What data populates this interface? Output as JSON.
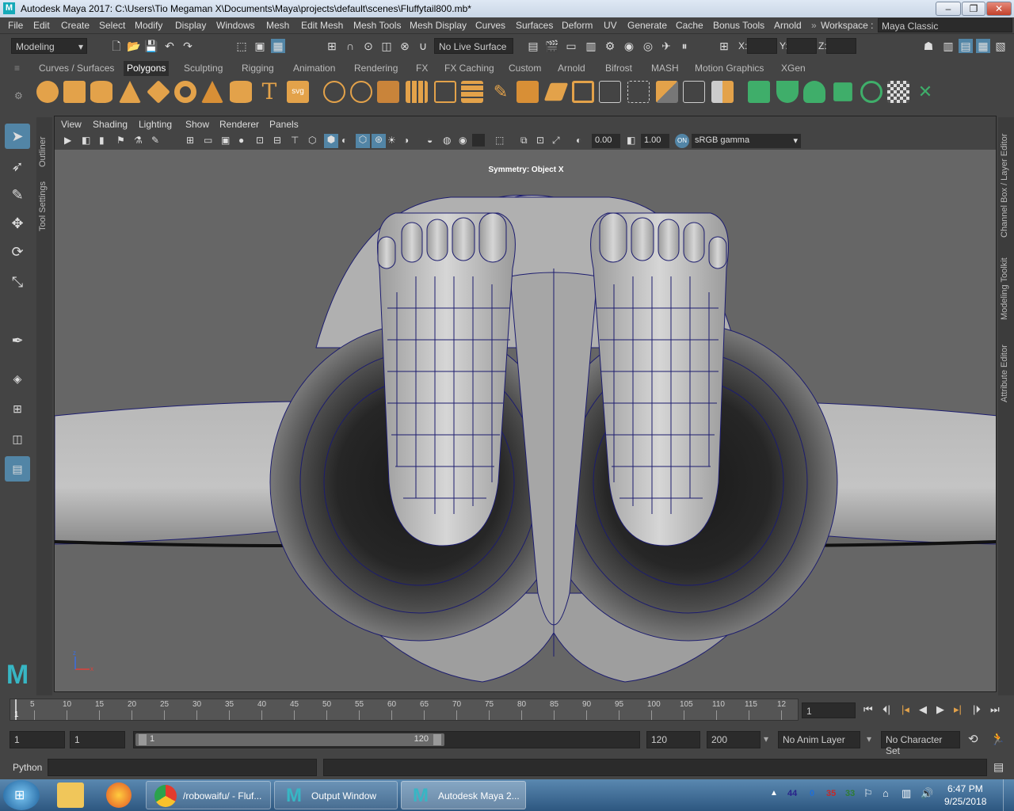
{
  "window": {
    "title": "Autodesk Maya 2017: C:\\Users\\Tio Megaman X\\Documents\\Maya\\projects\\default\\scenes\\Fluffytail800.mb*"
  },
  "menu": [
    "File",
    "Edit",
    "Create",
    "Select",
    "Modify",
    "Display",
    "Windows",
    "Mesh",
    "Edit Mesh",
    "Mesh Tools",
    "Mesh Display",
    "Curves",
    "Surfaces",
    "Deform",
    "UV",
    "Generate",
    "Cache",
    "Bonus Tools",
    "Arnold"
  ],
  "workspace": {
    "label": "Workspace :",
    "value": "Maya Classic"
  },
  "status": {
    "mode": "Modeling",
    "live_surface": "No Live Surface",
    "x_label": "X:",
    "y_label": "Y:",
    "z_label": "Z:"
  },
  "shelf_tabs": [
    "Curves / Surfaces",
    "Polygons",
    "Sculpting",
    "Rigging",
    "Animation",
    "Rendering",
    "FX",
    "FX Caching",
    "Custom",
    "Arnold",
    "Bifrost",
    "MASH",
    "Motion Graphics",
    "XGen"
  ],
  "shelf_active": "Polygons",
  "left_tabs": [
    "Outliner",
    "Tool Settings"
  ],
  "right_tabs": [
    "Channel Box / Layer Editor",
    "Modeling Toolkit",
    "Attribute Editor"
  ],
  "viewport": {
    "menus": [
      "View",
      "Shading",
      "Lighting",
      "Show",
      "Renderer",
      "Panels"
    ],
    "exposure": "0.00",
    "gamma": "1.00",
    "colorspace": "sRGB gamma",
    "hud": "Symmetry: Object X"
  },
  "timeline": {
    "ticks": [
      "5",
      "10",
      "15",
      "20",
      "25",
      "30",
      "35",
      "40",
      "45",
      "50",
      "55",
      "60",
      "65",
      "70",
      "75",
      "80",
      "85",
      "90",
      "95",
      "100",
      "105",
      "110",
      "115",
      "12"
    ],
    "start_marker": "1",
    "current_frame": "1"
  },
  "range": {
    "start": "1",
    "playback_start": "1",
    "slider_start": "1",
    "slider_end": "120",
    "playback_end": "120",
    "end": "200",
    "anim_layer": "No Anim Layer",
    "char_set": "No Character Set"
  },
  "cmd": {
    "label": "Python"
  },
  "taskbar": {
    "buttons": [
      "/robowaifu/ - Fluf...",
      "Output Window",
      "Autodesk Maya 2..."
    ],
    "tray": [
      "44",
      "0",
      "35",
      "33"
    ],
    "time": "6:47 PM",
    "date": "9/25/2018"
  },
  "colors": {
    "accent": "#5285a6",
    "mesh_wire": "#1c1c6e",
    "orange_icon": "#e3a24a",
    "green_icon": "#3fae6a"
  }
}
